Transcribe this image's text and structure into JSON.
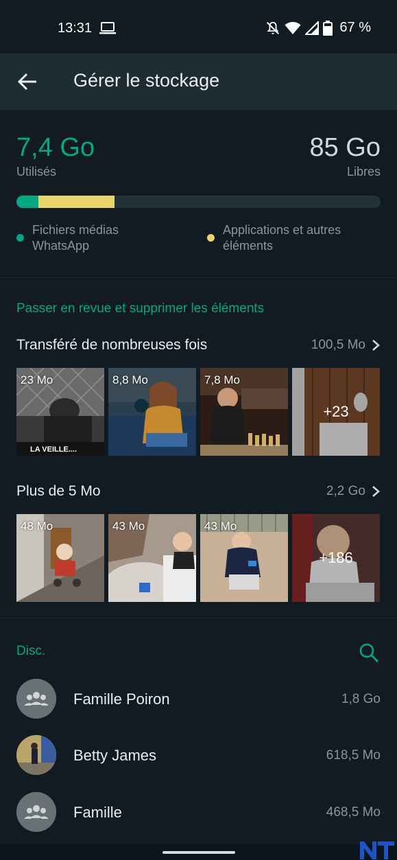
{
  "status_bar": {
    "time": "13:31",
    "battery": "67 %"
  },
  "app_bar": {
    "title": "Gérer le stockage"
  },
  "storage": {
    "used_value": "7,4 Go",
    "used_label": "Utilisés",
    "free_value": "85 Go",
    "free_label": "Libres",
    "whatsapp_fraction": 0.06,
    "apps_fraction": 0.21,
    "legend": [
      {
        "label": "Fichiers médias WhatsApp",
        "color": "#00a884"
      },
      {
        "label": "Applications et autres éléments",
        "color": "#ead667"
      }
    ]
  },
  "review": {
    "title": "Passer en revue et supprimer les éléments",
    "groups": [
      {
        "title": "Transféré de nombreuses fois",
        "size": "100,5 Mo",
        "thumbs": [
          {
            "size": "23 Mo",
            "caption": "LA VEILLE...."
          },
          {
            "size": "8,8 Mo"
          },
          {
            "size": "7,8 Mo"
          },
          {
            "more": "+23"
          }
        ]
      },
      {
        "title": "Plus de 5 Mo",
        "size": "2,2 Go",
        "thumbs": [
          {
            "size": "48 Mo"
          },
          {
            "size": "43 Mo"
          },
          {
            "size": "43 Mo"
          },
          {
            "more": "+186"
          }
        ]
      }
    ]
  },
  "chats": {
    "label": "Disc.",
    "items": [
      {
        "name": "Famille Poiron",
        "size": "1,8 Go"
      },
      {
        "name": "Betty James",
        "size": "618,5 Mo"
      },
      {
        "name": "Famille",
        "size": "468,5 Mo"
      }
    ]
  },
  "colors": {
    "accent": "#00a884",
    "apps": "#ead667",
    "background": "#111b21",
    "app_bar": "#1f2c34"
  },
  "icons": [
    "laptop-icon",
    "bell-off-icon",
    "wifi-icon",
    "signal-icon",
    "battery-icon",
    "back-arrow-icon",
    "chevron-right-icon",
    "search-icon",
    "group-icon"
  ]
}
